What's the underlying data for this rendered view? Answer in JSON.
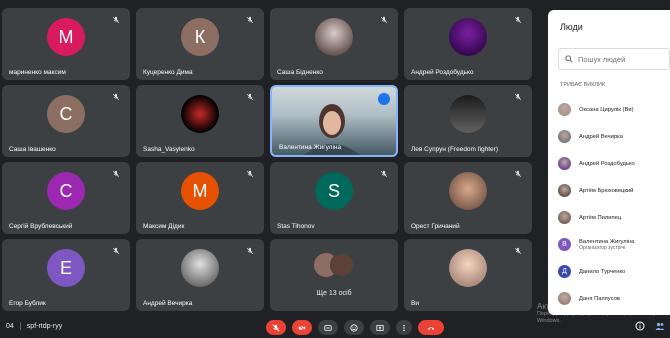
{
  "tiles": [
    {
      "name": "мариненко максим",
      "letter": "М",
      "color": "#d81b60",
      "kind": "letter"
    },
    {
      "name": "Куцеренко Дима",
      "letter": "К",
      "color": "#8d6e63",
      "kind": "letter"
    },
    {
      "name": "Саша Бідненко",
      "kind": "photo"
    },
    {
      "name": "Андрей Роздобудько",
      "kind": "photo-purple"
    },
    {
      "name": "Саша Івашенко",
      "letter": "С",
      "color": "#8d6e63",
      "kind": "letter"
    },
    {
      "name": "Sasha_Vasylenko",
      "kind": "biohazard"
    },
    {
      "name": "Валентина Жигуліна",
      "kind": "video"
    },
    {
      "name": "Лев Супрун (Freedom fighter)",
      "kind": "photo-hat"
    },
    {
      "name": "Сергій Врублевський",
      "letter": "С",
      "color": "#9c27b0",
      "kind": "letter"
    },
    {
      "name": "Максим Дідик",
      "letter": "М",
      "color": "#e65100",
      "kind": "letter"
    },
    {
      "name": "Stas Tihonov",
      "letter": "S",
      "color": "#00695c",
      "kind": "letter"
    },
    {
      "name": "Орест Гричаний",
      "kind": "photo-face"
    },
    {
      "name": "Егор Бублик",
      "letter": "Е",
      "color": "#7e57c2",
      "kind": "letter"
    },
    {
      "name": "Андрей Вечирка",
      "kind": "photo-bw"
    },
    {
      "name": "",
      "kind": "more",
      "label": "Ще 13 осіб"
    },
    {
      "name": "Ви",
      "kind": "photo-self"
    }
  ],
  "panel": {
    "title": "Люди",
    "search_placeholder": "Пошук людей",
    "section": "ТРИВАЄ ВИКЛИК",
    "people": [
      {
        "name": "Оксана Цирулік (Ви)",
        "sub": "",
        "kind": "photo",
        "color": "#a1887f"
      },
      {
        "name": "Андрей Вечирка",
        "sub": "",
        "kind": "photo",
        "color": "#616161"
      },
      {
        "name": "Андрей Роздобудько",
        "sub": "",
        "kind": "photo",
        "color": "#4a148c"
      },
      {
        "name": "Артём Брюховецкий",
        "sub": "",
        "kind": "photo",
        "color": "#3e2723"
      },
      {
        "name": "Артём Пилипец",
        "sub": "",
        "kind": "photo",
        "color": "#5d4037"
      },
      {
        "name": "Валентина Жигуліна",
        "sub": "Організатор зустрічі",
        "kind": "letter",
        "letter": "В",
        "color": "#7e57c2"
      },
      {
        "name": "Данило Турченко",
        "sub": "",
        "kind": "letter",
        "letter": "Д",
        "color": "#3949ab"
      },
      {
        "name": "Даня Паппусов",
        "sub": "",
        "kind": "photo",
        "color": "#8d6e63"
      }
    ]
  },
  "bottom": {
    "time": "04",
    "meeting_code": "spf-rtdp-ryy"
  },
  "watermark": {
    "line1": "Активация Windows",
    "line2": "Перейдіть до розділу \"Настройки\", щоб активувати Windows."
  },
  "colors": {
    "accent": "#8ab4f8",
    "danger": "#ea4335",
    "tile": "#3c4043"
  }
}
